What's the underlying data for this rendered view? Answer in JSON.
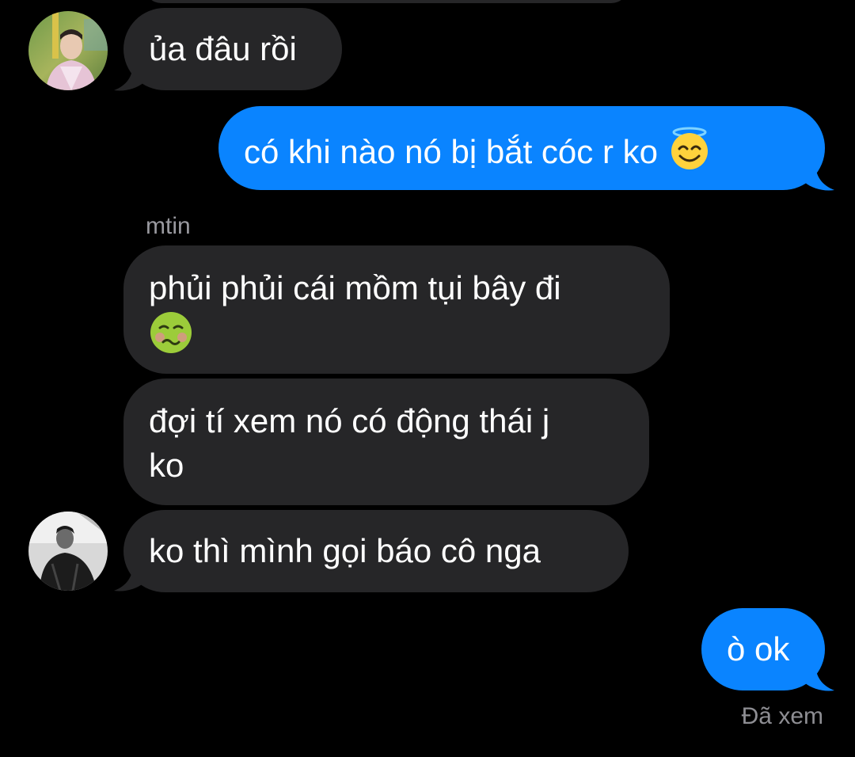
{
  "colors": {
    "background": "#000000",
    "incoming_bubble": "#262628",
    "outgoing_bubble": "#0a84ff",
    "text": "#ffffff",
    "secondary_text": "#8e8e93"
  },
  "messages": [
    {
      "direction": "incoming",
      "text": "ủa đâu rồi",
      "avatar": "avatar-photo-person-pink-shirt"
    },
    {
      "direction": "outgoing",
      "text": "có khi nào nó bị bắt cóc r ko",
      "emoji": "smiling-face-with-halo-icon"
    },
    {
      "direction": "incoming",
      "sender": "mtin",
      "line1": "phủi phủi cái mồm tụi bây đi",
      "emoji": "nauseated-face-icon"
    },
    {
      "direction": "incoming",
      "line1": "đợi tí xem nó có động thái j",
      "line2": "ko"
    },
    {
      "direction": "incoming",
      "text": "ko thì mình gọi báo cô nga",
      "avatar": "avatar-photo-person-black-white"
    },
    {
      "direction": "outgoing",
      "text": "ò ok"
    }
  ],
  "status": {
    "read_receipt": "Đã xem"
  }
}
